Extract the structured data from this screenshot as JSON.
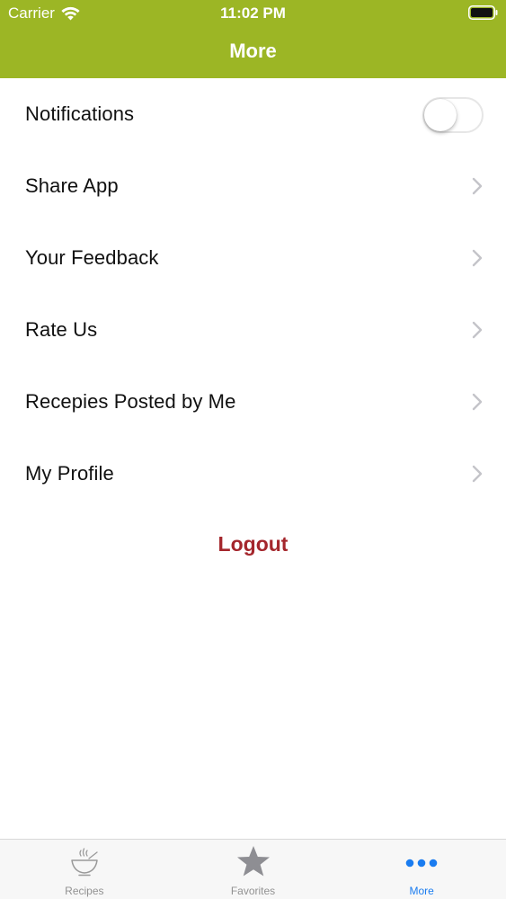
{
  "status_bar": {
    "carrier": "Carrier",
    "time": "11:02 PM"
  },
  "nav": {
    "title": "More"
  },
  "colors": {
    "header": "#9cb625",
    "logout": "#a4262c",
    "tab_active": "#1a7cf0",
    "tab_inactive": "#929292"
  },
  "settings": {
    "notifications_label": "Notifications",
    "notifications_on": false,
    "items": [
      {
        "label": "Share App"
      },
      {
        "label": "Your Feedback"
      },
      {
        "label": "Rate Us"
      },
      {
        "label": "Recepies Posted by Me"
      },
      {
        "label": "My Profile"
      }
    ]
  },
  "logout_label": "Logout",
  "tabs": [
    {
      "label": "Recipes",
      "icon": "bowl-icon",
      "active": false
    },
    {
      "label": "Favorites",
      "icon": "star-icon",
      "active": false
    },
    {
      "label": "More",
      "icon": "more-dots-icon",
      "active": true
    }
  ]
}
